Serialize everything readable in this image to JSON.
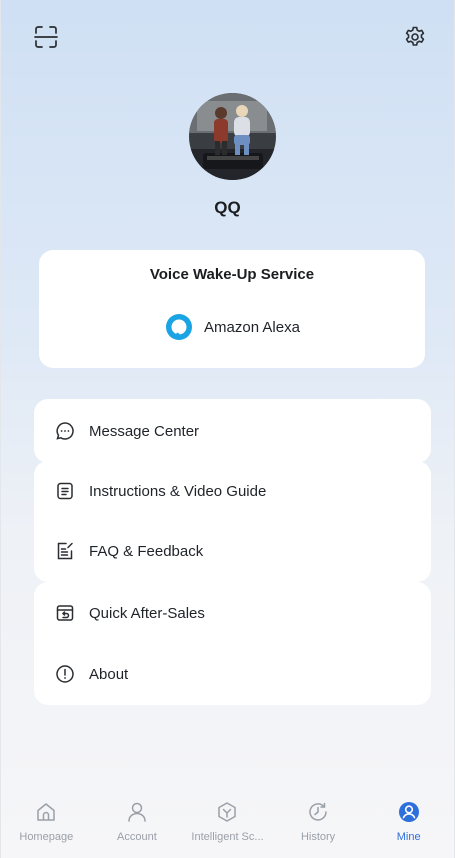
{
  "profile": {
    "username": "QQ",
    "avatar_icon": "avatar-photo"
  },
  "header": {
    "scan_icon": "scan-icon",
    "settings_icon": "gear-icon"
  },
  "voice_service": {
    "title": "Voice Wake-Up Service",
    "provider": "Amazon Alexa",
    "provider_icon": "alexa-ring-icon",
    "accent": "#1aa4e3"
  },
  "menu": {
    "items": [
      {
        "label": "Message Center",
        "icon": "message-bubble-icon"
      },
      {
        "label": "Instructions & Video Guide",
        "icon": "document-list-icon"
      },
      {
        "label": "FAQ & Feedback",
        "icon": "edit-note-icon"
      },
      {
        "label": "Quick After-Sales",
        "icon": "return-box-icon"
      },
      {
        "label": "About",
        "icon": "info-circle-icon"
      }
    ]
  },
  "tabbar": {
    "active_color": "#2f6fdb",
    "inactive_color": "#9aa0a8",
    "tabs": [
      {
        "label": "Homepage",
        "icon": "home-icon"
      },
      {
        "label": "Account",
        "icon": "person-icon"
      },
      {
        "label": "Intelligent Sc...",
        "icon": "smart-scene-icon"
      },
      {
        "label": "History",
        "icon": "clock-history-icon"
      },
      {
        "label": "Mine",
        "icon": "mine-profile-icon",
        "active": true
      }
    ]
  }
}
